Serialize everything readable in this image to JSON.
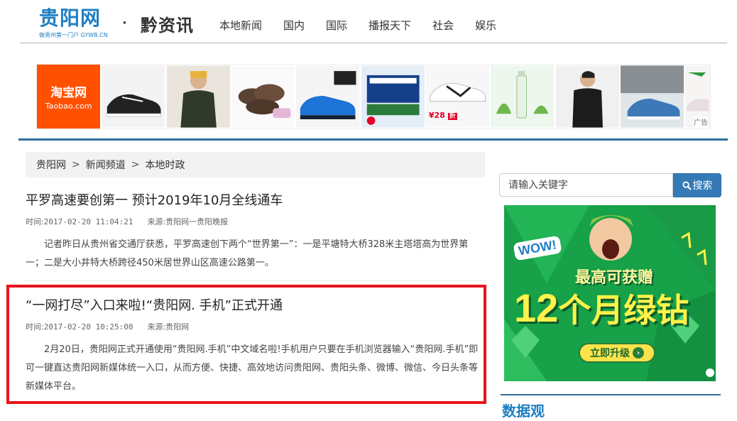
{
  "header": {
    "logo_text": "贵阳网",
    "logo_sub": "做贵州第一门户 GYWB.CN",
    "dot": "·",
    "channel": "黔资讯",
    "nav": [
      "本地新闻",
      "国内",
      "国际",
      "播报天下",
      "社会",
      "娱乐"
    ]
  },
  "banner": {
    "taobao_cn": "淘宝网",
    "taobao_en": "Taobao.com",
    "price": "¥28",
    "price_tag": "折",
    "ad_label": "广告"
  },
  "breadcrumb": {
    "items": [
      "贵阳网",
      "新闻频道",
      "本地时政"
    ],
    "separator": ">"
  },
  "articles": [
    {
      "title": "平罗高速要创第一  预计2019年10月全线通车",
      "time_label": "时间:",
      "time": "2017-02-20 11:04:21",
      "source_label": "来源:",
      "source": "贵阳网一贵阳晚报",
      "body": "记者昨日从贵州省交通厅获悉，平罗高速创下两个“世界第一”：一是平塘特大桥328米主塔塔高为世界第一；二是大小井特大桥跨径450米居世界山区高速公路第一。"
    },
    {
      "title": "“一网打尽”入口来啦!“贵阳网. 手机”正式开通",
      "time_label": "时间:",
      "time": "2017-02-20 10:25:00",
      "source_label": "来源:",
      "source": "贵阳网",
      "body": "2月20日，贵阳网正式开通使用“贵阳网.手机”中文域名啦!手机用户只要在手机浏览器输入“贵阳网.手机”即可一键直达贵阳网新媒体统一入口，从而方便、快捷、高效地访问贵阳网、贵阳头条、微博、微信、今日头条等新媒体平台。"
    }
  ],
  "search": {
    "placeholder": "请输入关键字",
    "button": "搜索"
  },
  "sidebar_ad": {
    "wow": "WOW!",
    "line1": "最高可获赠",
    "line2_num": "12",
    "line2_text": "个月绿钻",
    "button": "立即升级",
    "arrow": "›"
  },
  "data_section": {
    "title": "数据观"
  },
  "colors": {
    "brand_blue": "#1f7fc2",
    "divider_blue": "#2d6e9c",
    "highlight_red": "#e8141b",
    "taobao_orange": "#ff5000"
  }
}
